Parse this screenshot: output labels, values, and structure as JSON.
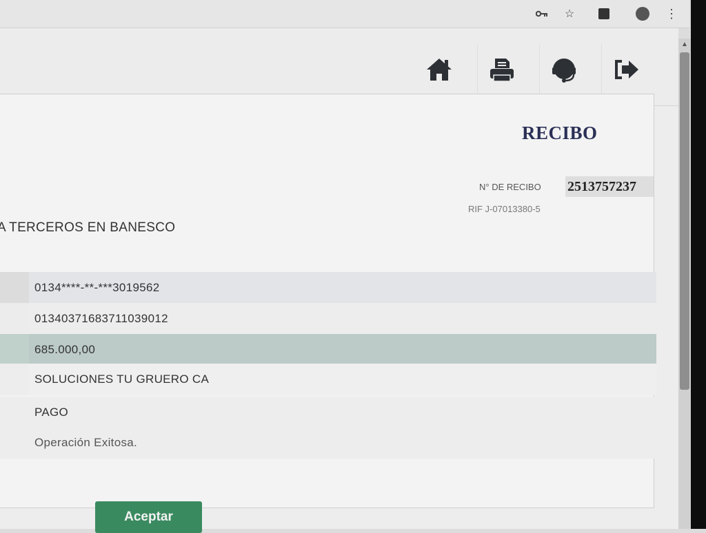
{
  "browser": {
    "icons": [
      "key-icon",
      "star-icon",
      "extension-icon",
      "profile-icon",
      "menu-icon"
    ]
  },
  "nav": {
    "icons": [
      "home-icon",
      "print-icon",
      "support-icon",
      "logout-icon"
    ],
    "icon_color": "#2d3035"
  },
  "receipt": {
    "title": "RECIBO",
    "number_label": "N° DE RECIBO",
    "number_value": "2513757237",
    "rif": "RIF J-07013380-5",
    "transfer_title": "A TERCEROS EN BANESCO"
  },
  "details": {
    "rows": [
      "0134****-**-***3019562",
      "01340371683711039012",
      "685.000,00",
      "SOLUCIONES TU GRUERO CA",
      "PAGO",
      "Operación Exitosa."
    ]
  },
  "actions": {
    "accept_label": "Aceptar",
    "accept_color": "#3a8a60"
  }
}
